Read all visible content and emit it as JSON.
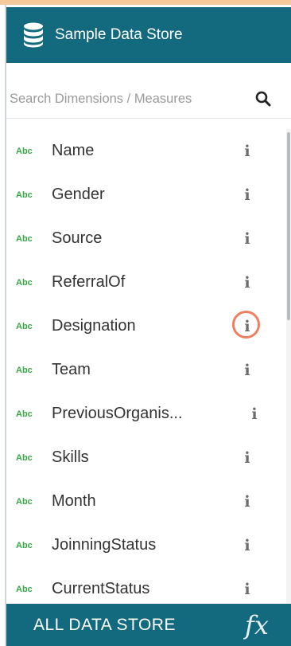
{
  "header": {
    "title": "Sample Data Store",
    "icon": "database-icon"
  },
  "search": {
    "placeholder": "Search Dimensions / Measures",
    "icon": "search-icon"
  },
  "fields": [
    {
      "type_badge": "Abc",
      "label": "Name",
      "info": "i"
    },
    {
      "type_badge": "Abc",
      "label": "Gender",
      "info": "i"
    },
    {
      "type_badge": "Abc",
      "label": "Source",
      "info": "i"
    },
    {
      "type_badge": "Abc",
      "label": "ReferralOf",
      "info": "i"
    },
    {
      "type_badge": "Abc",
      "label": "Designation",
      "info": "i"
    },
    {
      "type_badge": "Abc",
      "label": "Team",
      "info": "i"
    },
    {
      "type_badge": "Abc",
      "label": "PreviousOrganis...",
      "info": "i"
    },
    {
      "type_badge": "Abc",
      "label": "Skills",
      "info": "i"
    },
    {
      "type_badge": "Abc",
      "label": "Month",
      "info": "i"
    },
    {
      "type_badge": "Abc",
      "label": "JoinningStatus",
      "info": "i"
    },
    {
      "type_badge": "Abc",
      "label": "CurrentStatus",
      "info": "i"
    }
  ],
  "footer": {
    "label": "ALL DATA STORE",
    "formula_icon": "fx"
  },
  "colors": {
    "header_bg": "#136a7e",
    "badge": "#3aa648",
    "highlight_ring": "#ef7f5e"
  }
}
